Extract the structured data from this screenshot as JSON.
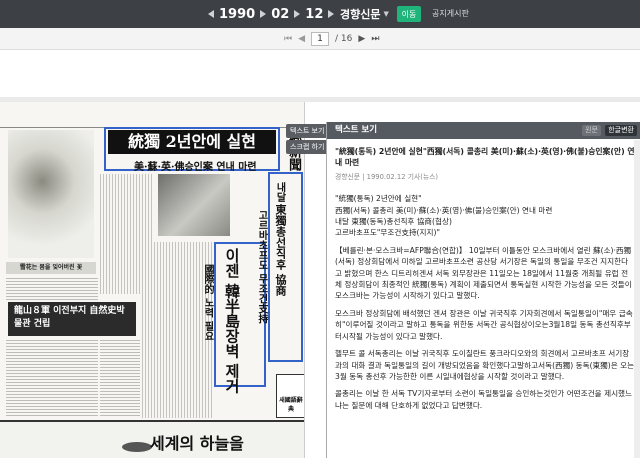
{
  "topbar": {
    "year": "1990",
    "month": "02",
    "day": "12",
    "newspaper": "경향신문",
    "move_label": "이동",
    "notice_label": "공지게시판"
  },
  "pager": {
    "current": "1",
    "total": "/ 16"
  },
  "scan": {
    "headline": "統獨 2년안에 실현",
    "subheadline": "美·蘇·英·佛승인案 연내 마련",
    "vertical_main": "이젠 韓半島장벽 제거",
    "vertical_side": "國際的 노력 필요",
    "vertical_right1": "東獨총선직후 協商",
    "vertical_right2": "고르바초프도 무조건支持",
    "vertical_right3": "내달",
    "paper_title": "鄕新聞",
    "dark_strip": "龍山８軍 이전부지 自然史박물관 건립",
    "flower_caption": "雪花는 봄을 잊어버린 꽃",
    "ad_text": "세계의 하늘을",
    "dict_label": "새國語辭典"
  },
  "tabs": {
    "text_view": "텍스트 보기",
    "scrap": "스크랩 하기"
  },
  "panel": {
    "title": "텍스트 보기",
    "orig_label": "원문",
    "convert_label": "한글변환",
    "article_title": "\"統獨(통독) 2년안에 실현\"西獨(서독) 콜총리 美(미)·蘇(소)·英(영)·佛(불)승인案(안) 연내 마련",
    "meta": "경향신문 | 1990.02.12 기사(뉴스)",
    "p1": "\"統獨(통독) 2년안에 실현\"",
    "p2": "西獨(서독) 콜총리 美(미)·蘇(소)·英(영)·佛(불)승인案(안) 연내 마련",
    "p3": "내달 東獨(동독)총선직후 協商(협상)",
    "p4": "고르바초프도\"무조건支持(지지)\"",
    "p5": "【베를린·본·모스크바=AFP聯合(연합)】 10일부터 이틀동안 모스크바에서 열린 蘇(소)·西獨(서독) 정상회담에서 미하일 고르바초프소련 공산당 서기장은 독일의 통일을 무조건 지지한다고 밝혔으며 한스 디트리히겐셔 서독 외무장관은 11일오는 18일에서 11월중 개최될 유럽 전체 정상회담이 최종적인 統獨(통독) 계획이 제출되면서 통독실현 시작한 가능성을 모든 것들이 모스크바는 가능성이 시작하기 있다고 말했다.",
    "p6": "모스크바 정상회담에 배석했던 겐셔 장관은 이날 귀국직후 기자회견에서 독일통일이\"매우 급속히\"이루어질 것이라고 말하고 통독을 위한동 서독간 공식협상이오는3월18일 동독 총선직후부터시작될 가능성이 있다고 말했다.",
    "p7": "헬무트 콜 서독총리는 이날 귀국직후 도이칠란트 풍크라디오와의 회견에서 고르바초프 서기장과의 대화 결과 독일통일의 길이 개방되었음을 확인했다고말하고서독(西獨) 동독(東獨)은 오는 3월 동독 총선후 가능한한 이른 시일내에협상을 시작할 것이라고 말했다.",
    "p8": "콜총리는 이날 한 서독 TV기자로부터 소련이 독일통일을 승인하는것인가 어떤조건을 제시했느냐는 질문에 대해 단호하게 없었다고 답변했다."
  },
  "colors": {
    "topbar_bg": "#3d4146",
    "move_green": "#1fb47a",
    "panel_head": "#555a60",
    "highlight_blue": "#3363c9",
    "accent_red": "#c33"
  }
}
